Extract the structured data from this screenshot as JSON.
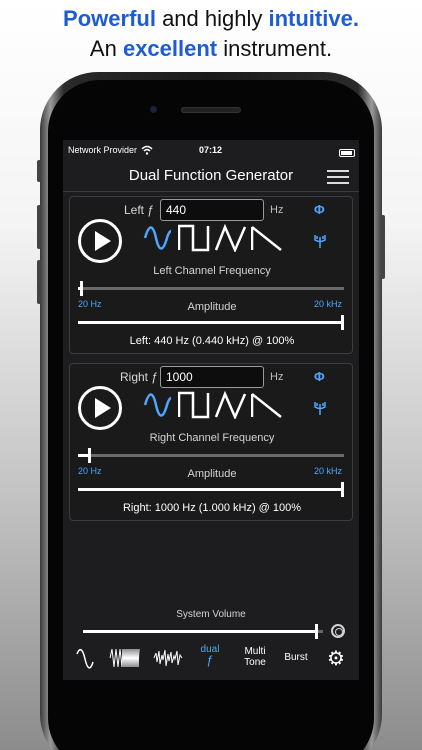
{
  "headline": {
    "line1_a": "Powerful",
    "line1_b": " and highly ",
    "line1_c": "intuitive.",
    "line2_a": "An ",
    "line2_b": "excellent",
    "line2_c": " instrument."
  },
  "status_bar": {
    "carrier": "Network Provider",
    "time": "07:12"
  },
  "app": {
    "title": "Dual Function Generator"
  },
  "left_channel": {
    "label": "Left ƒ",
    "frequency_value": "440",
    "unit": "Hz",
    "phase_symbol": "Φ",
    "frequency_label": "Left Channel Frequency",
    "freq_slider_fraction": 0.02,
    "min_label": "20 Hz",
    "max_label": "20 kHz",
    "amplitude_label": "Amplitude",
    "amplitude_fraction": 1.0,
    "readout": "Left: 440 Hz (0.440 kHz) @ 100%",
    "selected_wave": "sine"
  },
  "right_channel": {
    "label": "Right ƒ",
    "frequency_value": "1000",
    "unit": "Hz",
    "phase_symbol": "Φ",
    "frequency_label": "Right Channel Frequency",
    "freq_slider_fraction": 0.05,
    "min_label": "20 Hz",
    "max_label": "20 kHz",
    "amplitude_label": "Amplitude",
    "amplitude_fraction": 1.0,
    "readout": "Right: 1000 Hz (1.000 kHz) @ 100%",
    "selected_wave": "sine"
  },
  "system_volume": {
    "label": "System Volume",
    "fraction": 0.98
  },
  "tabs": {
    "dual_line1": "dual",
    "dual_line2": "ƒ",
    "multi_line1": "Multi",
    "multi_line2": "Tone",
    "burst": "Burst"
  },
  "icons": {
    "play": "play-icon",
    "sine": "sine-wave-icon",
    "square": "square-wave-icon",
    "triangle": "triangle-wave-icon",
    "sawtooth": "sawtooth-wave-icon",
    "antenna": "antenna-icon",
    "menu": "menu-icon",
    "gear": "gear-icon",
    "airplay": "airplay-icon"
  },
  "colors": {
    "accent": "#4ea6ff",
    "headline_accent": "#1e5cd6",
    "screen_bg": "#1d1d1f"
  }
}
